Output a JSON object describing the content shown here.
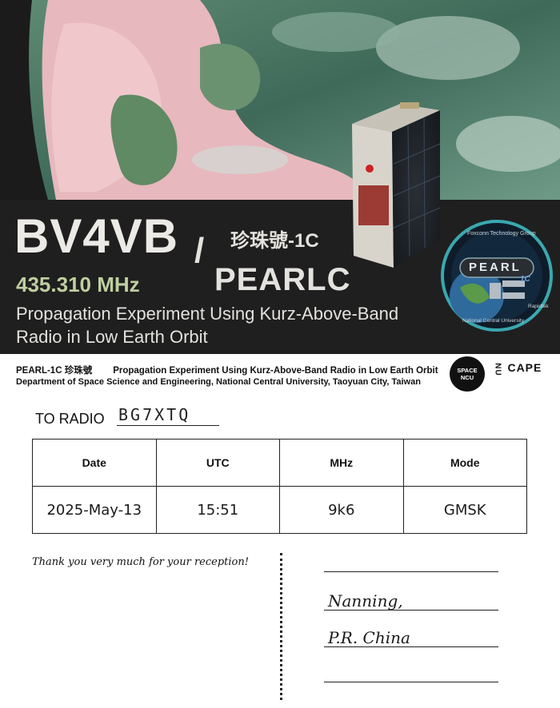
{
  "banner": {
    "callsign": "BV4VB",
    "slash": "/",
    "chinese_name": "珍珠號-1C",
    "satellite_name": "PEARLC",
    "frequency": "435.310 MHz",
    "experiment_line1": "Propagation Experiment Using Kurz-Above-Band",
    "experiment_line2": "Radio in Low Earth Orbit",
    "badge": {
      "top_text": "Foxconn Technology Group",
      "name": "PEARL",
      "sub": "1C",
      "bottom_text": "National Central University",
      "side_text": "Rapidtek"
    }
  },
  "info": {
    "mission_name": "PEARL-1C 珍珠號",
    "mission_desc": "Propagation Experiment Using Kurz-Above-Band Radio in Low Earth Orbit",
    "department": "Department of Space Science and Engineering, National Central University, Taoyuan City, Taiwan",
    "logo_space_line1": "SPACE",
    "logo_space_line2": "NCU",
    "logo_cape": "CAPE"
  },
  "to_radio": {
    "label": "TO RADIO",
    "callsign": "BG7XTQ"
  },
  "log_table": {
    "headers": [
      "Date",
      "UTC",
      "MHz",
      "Mode"
    ],
    "row": [
      "2025-May-13",
      "15:51",
      "9k6",
      "GMSK"
    ]
  },
  "footer": {
    "thanks": "Thank you very much for your reception!",
    "address_line1": "Nanning,",
    "address_line2": "P.R. China"
  },
  "colors": {
    "frequency": "#bfcfa0",
    "banner_text": "#e4e2de",
    "badge_ring": "#3aa8b0"
  }
}
